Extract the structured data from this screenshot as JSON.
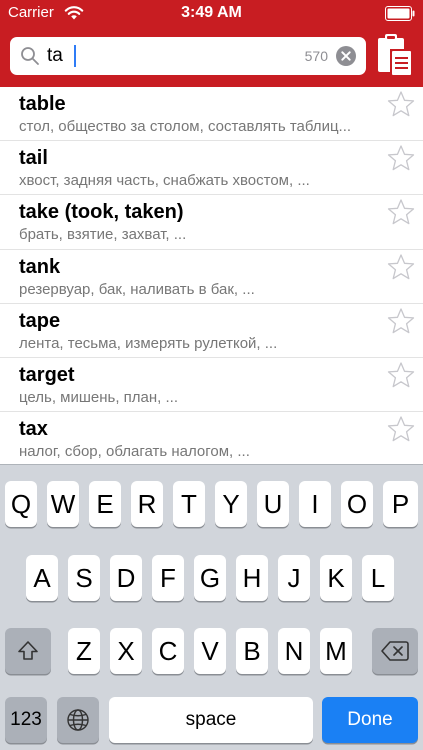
{
  "status": {
    "carrier": "Carrier",
    "time": "3:49 AM"
  },
  "search": {
    "query": "ta",
    "count": "570"
  },
  "results": [
    {
      "word": "table",
      "translation": "стол, общество за столом, составлять таблиц..."
    },
    {
      "word": "tail",
      "translation": "хвост, задняя часть, снабжать хвостом, ..."
    },
    {
      "word": "take (took, taken)",
      "translation": "брать, взятие, захват, ..."
    },
    {
      "word": "tank",
      "translation": "резервуар, бак, наливать в бак, ..."
    },
    {
      "word": "tape",
      "translation": "лента, тесьма, измерять рулеткой, ..."
    },
    {
      "word": "target",
      "translation": "цель, мишень, план, ..."
    },
    {
      "word": "tax",
      "translation": "налог, сбор, облагать налогом, ..."
    }
  ],
  "keyboard": {
    "row1": [
      "Q",
      "W",
      "E",
      "R",
      "T",
      "Y",
      "U",
      "I",
      "O",
      "P"
    ],
    "row2": [
      "A",
      "S",
      "D",
      "F",
      "G",
      "H",
      "J",
      "K",
      "L"
    ],
    "row3": [
      "Z",
      "X",
      "C",
      "V",
      "B",
      "N",
      "M"
    ],
    "numbers_label": "123",
    "space_label": "space",
    "done_label": "Done"
  },
  "colors": {
    "header": "#c81d22",
    "done_key": "#1a80f4",
    "keyboard_bg": "#d1d5db"
  }
}
